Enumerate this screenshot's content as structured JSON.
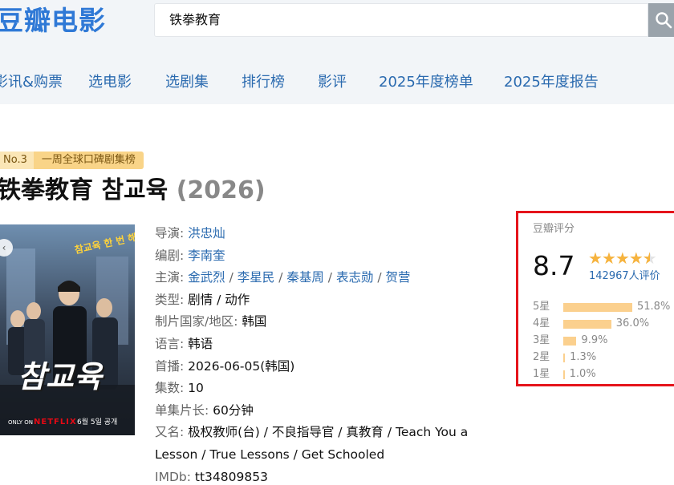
{
  "header": {
    "logo_text": "豆瓣电影",
    "search_value": "铁拳教育"
  },
  "nav": {
    "items": [
      {
        "label": "影讯&购票"
      },
      {
        "label": "选电影"
      },
      {
        "label": "选剧集"
      },
      {
        "label": "排行榜"
      },
      {
        "label": "影评"
      },
      {
        "label": "2025年度榜单"
      },
      {
        "label": "2025年度报告"
      }
    ]
  },
  "badge": {
    "rank": "No.3",
    "list_name": "一周全球口碑剧集榜"
  },
  "title": {
    "main": "铁拳教育 참교육",
    "year": "(2026)"
  },
  "poster": {
    "korean_title": "참교육",
    "tagline": "참교육 한 번 해볼래?",
    "brand": "NETFLIX",
    "only_on": "ONLY ON",
    "date_text": "6월 5일 공개"
  },
  "info": {
    "director_label": "导演:",
    "director": "洪忠灿",
    "writer_label": "编剧:",
    "writer": "李南奎",
    "cast_label": "主演:",
    "cast": [
      "金武烈",
      "李星民",
      "秦基周",
      "表志勋",
      "贺营"
    ],
    "genre_label": "类型:",
    "genre": "剧情 / 动作",
    "country_label": "制片国家/地区:",
    "country": "韩国",
    "language_label": "语言:",
    "language": "韩语",
    "premiere_label": "首播:",
    "premiere": "2026-06-05(韩国)",
    "episodes_label": "集数:",
    "episodes": "10",
    "runtime_label": "单集片长:",
    "runtime": "60分钟",
    "aka_label": "又名:",
    "aka": "极权教师(台) / 不良指导官 / 真教育 / Teach You a Lesson / True Lessons / Get Schooled",
    "imdb_label": "IMDb:",
    "imdb": "tt34809853"
  },
  "rating": {
    "label": "豆瓣评分",
    "score": "8.7",
    "votes": "142967人评价",
    "distribution": [
      {
        "label": "5星",
        "pct_text": "51.8%",
        "pct": 51.8
      },
      {
        "label": "4星",
        "pct_text": "36.0%",
        "pct": 36.0
      },
      {
        "label": "3星",
        "pct_text": "9.9%",
        "pct": 9.9
      },
      {
        "label": "2星",
        "pct_text": "1.3%",
        "pct": 1.3
      },
      {
        "label": "1星",
        "pct_text": "1.0%",
        "pct": 1.0
      }
    ],
    "colors": {
      "star": "#f6b33e",
      "bar": "#fbd08e",
      "highlight_border": "#e5141b"
    }
  }
}
